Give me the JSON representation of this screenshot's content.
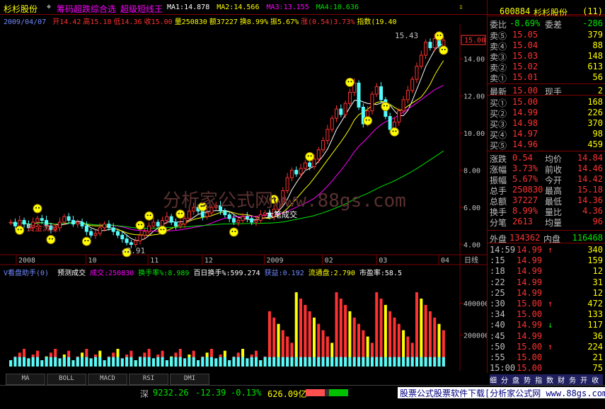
{
  "header": {
    "stock_name": "杉杉股份",
    "tabs": [
      "筹码超跌综合选",
      "超级短线王"
    ],
    "ma": [
      {
        "label": "MA1:",
        "value": "14.878",
        "color": "#ffffff"
      },
      {
        "label": "MA2:",
        "value": "14.566",
        "color": "#ffff00"
      },
      {
        "label": "MA3:",
        "value": "13.155",
        "color": "#ff00ff"
      },
      {
        "label": "MA4:",
        "value": "10.636",
        "color": "#00e600"
      }
    ],
    "info_date": "2009/04/07",
    "info_items": [
      {
        "label": "开",
        "value": "14.42",
        "color": "#ff3232"
      },
      {
        "label": "高",
        "value": "15.18",
        "color": "#ff3232"
      },
      {
        "label": "低",
        "value": "14.36",
        "color": "#ff3232"
      },
      {
        "label": "收",
        "value": "15.00",
        "color": "#ff3232"
      },
      {
        "label": "量",
        "value": "250830",
        "color": "#ffff00"
      },
      {
        "label": "额",
        "value": "37227",
        "color": "#ffff00"
      },
      {
        "label": "换",
        "value": "8.99%",
        "color": "#ffff00"
      },
      {
        "label": "振",
        "value": "5.67%",
        "color": "#ffff00"
      },
      {
        "label": "涨",
        "value": "(0.54)3.73%",
        "color": "#ff3232"
      },
      {
        "label": "指数",
        "value": "(19.40",
        "color": "#ffff00"
      }
    ]
  },
  "chart": {
    "high_label": "15.43",
    "low_label": "3.91",
    "note_left": "资金流没",
    "note_mid": "大笔成交",
    "watermark": "分析家公式网www.88gs.com",
    "right_current": "15.00",
    "price_ticks": [
      "14.00",
      "12.00",
      "10.00",
      "8.00",
      "6.00",
      "4.00"
    ],
    "date_ticks": [
      "2008",
      "10",
      "11",
      "12",
      "2009",
      "02",
      "03",
      "04"
    ],
    "date_tab": "日线"
  },
  "vol_header": {
    "title": "V看盘助手(0)",
    "items": [
      {
        "label": "预测成交",
        "value": "",
        "color": "#ffffff"
      },
      {
        "label": "成交:",
        "value": "250830",
        "color": "#ff00ff"
      },
      {
        "label": "换手率%:",
        "value": "8.989",
        "color": "#00e600"
      },
      {
        "label": "百日换手%:",
        "value": "599.274",
        "color": "#ffffff"
      },
      {
        "label": "获益:",
        "value": "0.192",
        "color": "#6f8bff"
      },
      {
        "label": "流通盘:",
        "value": "2.790",
        "color": "#ffff00"
      },
      {
        "label": "市盈率:",
        "value": "58.5",
        "color": "#ffffff"
      }
    ],
    "vol_ticks": [
      "400000",
      "200000"
    ]
  },
  "chart_data": {
    "type": "candlestick",
    "xlabel": "",
    "ylabel": "",
    "ylim": [
      3.6,
      15.8
    ],
    "series_note": "approx daily closes 2008-09 to 2009-04",
    "closes": [
      5.2,
      5.0,
      5.3,
      5.1,
      4.9,
      5.2,
      5.4,
      5.3,
      5.0,
      4.8,
      4.9,
      5.2,
      5.5,
      5.3,
      5.1,
      5.2,
      5.0,
      4.7,
      4.5,
      4.6,
      4.9,
      5.1,
      4.9,
      4.7,
      4.5,
      4.3,
      4.1,
      4.0,
      4.2,
      4.5,
      4.7,
      5.0,
      5.2,
      5.0,
      5.3,
      5.5,
      5.2,
      5.0,
      5.1,
      5.4,
      5.8,
      6.0,
      5.8,
      5.5,
      5.7,
      6.0,
      6.1,
      5.8,
      5.6,
      5.4,
      5.2,
      5.3,
      5.5,
      5.4,
      5.2,
      5.3,
      5.6,
      5.7,
      5.5,
      5.9,
      6.3,
      6.9,
      7.6,
      8.0,
      7.8,
      8.1,
      8.4,
      8.2,
      8.6,
      9.1,
      9.6,
      10.2,
      10.8,
      11.3,
      11.0,
      11.6,
      12.2,
      12.7,
      11.4,
      10.5,
      11.2,
      12.1,
      12.5,
      11.8,
      10.9,
      10.2,
      10.6,
      11.2,
      11.8,
      12.3,
      12.9,
      13.6,
      14.2,
      14.9,
      14.6,
      15.1,
      14.7,
      15.0
    ],
    "vol_max": 600000,
    "vol_ticks": [
      200000,
      400000
    ],
    "ma_last": {
      "MA1": 14.878,
      "MA2": 14.566,
      "MA3": 13.155,
      "MA4": 10.636
    }
  },
  "quote_panel": {
    "code": "600884",
    "name": "杉杉股份",
    "badge": "(11)",
    "wei_bi": {
      "label": "委比",
      "value": "-8.69%",
      "label2": "委差",
      "value2": "-286"
    },
    "asks": [
      {
        "label": "卖⑤",
        "price": "15.05",
        "vol": "379"
      },
      {
        "label": "卖④",
        "price": "15.04",
        "vol": "88"
      },
      {
        "label": "卖③",
        "price": "15.03",
        "vol": "148"
      },
      {
        "label": "卖②",
        "price": "15.02",
        "vol": "613"
      },
      {
        "label": "卖①",
        "price": "15.01",
        "vol": "56"
      }
    ],
    "last": {
      "label": "最新",
      "price": "15.00",
      "label2": "现手",
      "value2": "2"
    },
    "bids": [
      {
        "label": "买①",
        "price": "15.00",
        "vol": "168"
      },
      {
        "label": "买②",
        "price": "14.99",
        "vol": "226"
      },
      {
        "label": "买③",
        "price": "14.98",
        "vol": "370"
      },
      {
        "label": "买④",
        "price": "14.97",
        "vol": "98"
      },
      {
        "label": "买⑤",
        "price": "14.96",
        "vol": "459"
      }
    ],
    "stats": [
      {
        "l1": "涨跌",
        "v1": "0.54",
        "l2": "均价",
        "v2": "14.84"
      },
      {
        "l1": "涨幅",
        "v1": "3.73%",
        "l2": "前收",
        "v2": "14.46"
      },
      {
        "l1": "振幅",
        "v1": "5.67%",
        "l2": "今开",
        "v2": "14.42"
      },
      {
        "l1": "总手",
        "v1": "250830",
        "l2": "最高",
        "v2": "15.18"
      },
      {
        "l1": "总额",
        "v1": "37227",
        "l2": "最低",
        "v2": "14.36"
      },
      {
        "l1": "换手",
        "v1": "8.99%",
        "l2": "量比",
        "v2": "4.36"
      },
      {
        "l1": "分笔",
        "v1": "2613",
        "l2": "均量",
        "v2": "96"
      }
    ],
    "outer": {
      "l1": "外盘",
      "v1": "134362",
      "l2": "内盘",
      "v2": "116468"
    },
    "ticks": [
      {
        "time": "14:59",
        "price": "14.99",
        "arrow": "↑",
        "vol": "340"
      },
      {
        "time": ":15",
        "price": "14.99",
        "arrow": "",
        "vol": "159"
      },
      {
        "time": ":18",
        "price": "14.99",
        "arrow": "",
        "vol": "12"
      },
      {
        "time": ":22",
        "price": "14.99",
        "arrow": "",
        "vol": "31"
      },
      {
        "time": ":25",
        "price": "14.99",
        "arrow": "",
        "vol": "12"
      },
      {
        "time": ":30",
        "price": "15.00",
        "arrow": "↑",
        "vol": "472"
      },
      {
        "time": ":34",
        "price": "15.00",
        "arrow": "",
        "vol": "133"
      },
      {
        "time": ":40",
        "price": "14.99",
        "arrow": "↓",
        "vol": "117"
      },
      {
        "time": ":45",
        "price": "14.99",
        "arrow": "",
        "vol": "36"
      },
      {
        "time": ":50",
        "price": "15.00",
        "arrow": "↑",
        "vol": "224"
      },
      {
        "time": ":55",
        "price": "15.00",
        "arrow": "",
        "vol": "21"
      },
      {
        "time": "15:00",
        "price": "15.00",
        "arrow": "",
        "vol": "75"
      }
    ],
    "bottom_tabs": "细 分 盘 势 指 数 财 务 开 收"
  },
  "indicator_tabs": [
    "MA",
    "BOLL",
    "MACD",
    "RSI",
    "DMI"
  ],
  "status": {
    "index_name": "深",
    "index_value": "9232.26",
    "index_change": "-12.39",
    "index_pct": "-0.13%",
    "index_amount": "626.09亿",
    "ad_text": "股票公式股票软件下载[分析家公式网 www.88gs.com]"
  }
}
